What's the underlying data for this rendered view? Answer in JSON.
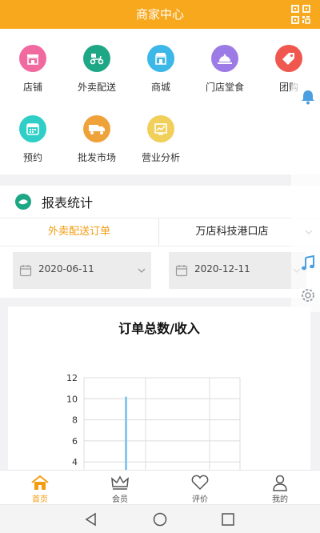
{
  "header": {
    "title": "商家中心"
  },
  "grid": [
    {
      "label": "店铺",
      "icon": "shop-icon",
      "color": "#f06aa0"
    },
    {
      "label": "外卖配送",
      "icon": "delivery-scooter-icon",
      "color": "#1ea785"
    },
    {
      "label": "商城",
      "icon": "mall-icon",
      "color": "#3bb7e8"
    },
    {
      "label": "门店堂食",
      "icon": "dining-cloche-icon",
      "color": "#9d7be6"
    },
    {
      "label": "团购",
      "icon": "group-buy-tag-icon",
      "color": "#f0574f"
    },
    {
      "label": "预约",
      "icon": "calendar-icon",
      "color": "#2fcfc7"
    },
    {
      "label": "批发市场",
      "icon": "wholesale-truck-icon",
      "color": "#f0a23a"
    },
    {
      "label": "营业分析",
      "icon": "analysis-chart-icon",
      "color": "#f0cf5a"
    }
  ],
  "report": {
    "title": "报表统计",
    "tab_active": "外卖配送订单",
    "store": "万店科技港口店",
    "date_start": "2020-06-11",
    "date_end": "2020-12-11"
  },
  "chart_data": {
    "type": "bar",
    "title": "订单总数/收入",
    "yticks": [
      4,
      6,
      8,
      10,
      12
    ],
    "ylim": [
      4,
      12
    ],
    "values": [
      10.2
    ],
    "bar_color": "#86c8ee",
    "grid": true
  },
  "tabbar": [
    {
      "label": "首页",
      "icon": "home-icon",
      "active": true
    },
    {
      "label": "会员",
      "icon": "crown-icon",
      "active": false
    },
    {
      "label": "评价",
      "icon": "heart-icon",
      "active": false
    },
    {
      "label": "我的",
      "icon": "user-icon",
      "active": false
    }
  ]
}
